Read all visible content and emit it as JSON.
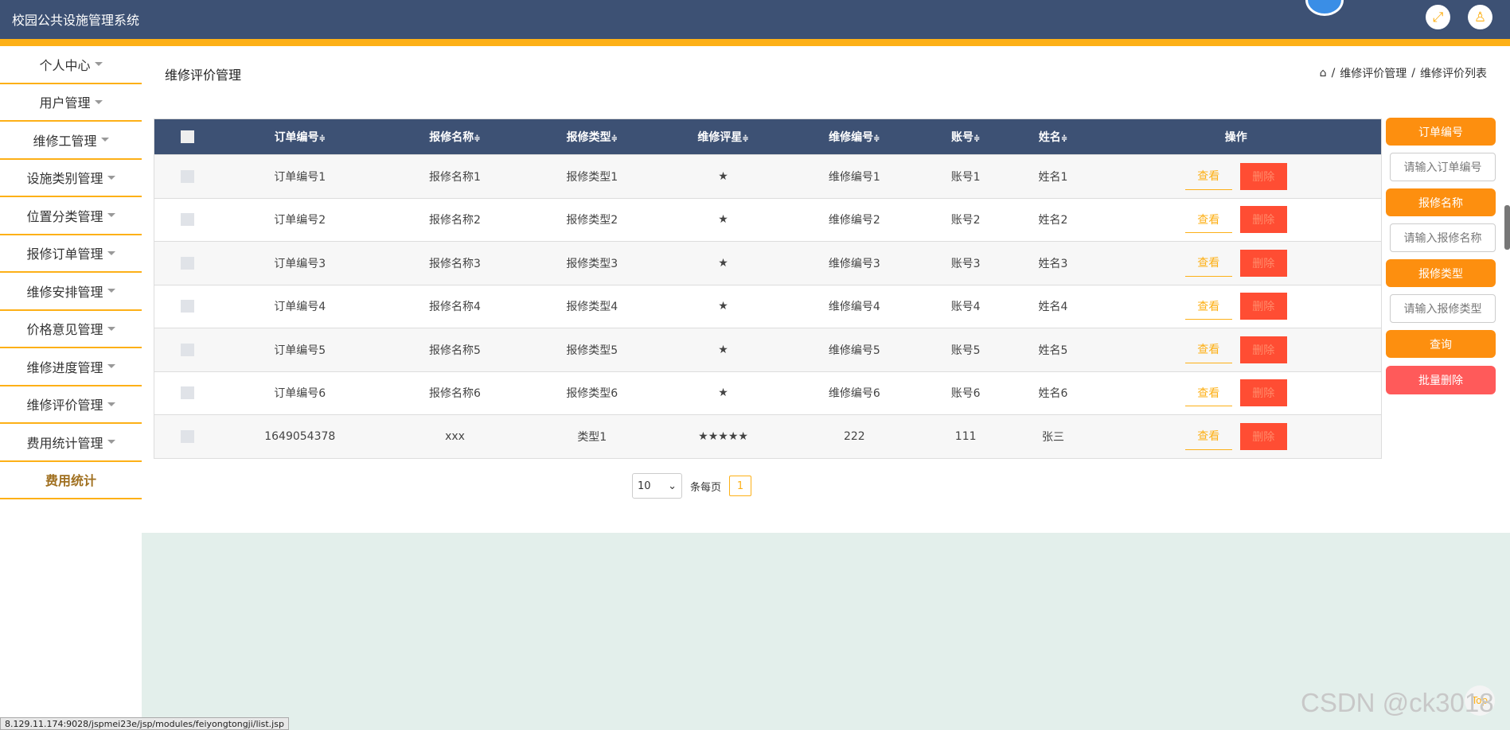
{
  "app": {
    "title": "校园公共设施管理系统"
  },
  "sidebar": {
    "items": [
      {
        "label": "个人中心",
        "caret": true
      },
      {
        "label": "用户管理",
        "caret": true
      },
      {
        "label": "维修工管理",
        "caret": true
      },
      {
        "label": "设施类别管理",
        "caret": true
      },
      {
        "label": "位置分类管理",
        "caret": true
      },
      {
        "label": "报修订单管理",
        "caret": true
      },
      {
        "label": "维修安排管理",
        "caret": true
      },
      {
        "label": "价格意见管理",
        "caret": true
      },
      {
        "label": "维修进度管理",
        "caret": true
      },
      {
        "label": "维修评价管理",
        "caret": true
      },
      {
        "label": "费用统计管理",
        "caret": true
      },
      {
        "label": "费用统计",
        "caret": false
      }
    ]
  },
  "page": {
    "title": "维修评价管理"
  },
  "breadcrumb": {
    "home_icon": "home-icon",
    "sep": "/",
    "level1": "维修评价管理",
    "level2": "维修评价列表"
  },
  "table": {
    "headers": [
      "订单编号",
      "报修名称",
      "报修类型",
      "维修评星",
      "维修编号",
      "账号",
      "姓名",
      "操作"
    ],
    "sort_glyph": "≑",
    "view_label": "查看",
    "delete_label": "删除",
    "rows": [
      [
        "订单编号1",
        "报修名称1",
        "报修类型1",
        "★",
        "维修编号1",
        "账号1",
        "姓名1"
      ],
      [
        "订单编号2",
        "报修名称2",
        "报修类型2",
        "★",
        "维修编号2",
        "账号2",
        "姓名2"
      ],
      [
        "订单编号3",
        "报修名称3",
        "报修类型3",
        "★",
        "维修编号3",
        "账号3",
        "姓名3"
      ],
      [
        "订单编号4",
        "报修名称4",
        "报修类型4",
        "★",
        "维修编号4",
        "账号4",
        "姓名4"
      ],
      [
        "订单编号5",
        "报修名称5",
        "报修类型5",
        "★",
        "维修编号5",
        "账号5",
        "姓名5"
      ],
      [
        "订单编号6",
        "报修名称6",
        "报修类型6",
        "★",
        "维修编号6",
        "账号6",
        "姓名6"
      ],
      [
        "1649054378",
        "xxx",
        "类型1",
        "★★★★★",
        "222",
        "111",
        "张三"
      ]
    ]
  },
  "pager": {
    "page_size": "10",
    "per_page_label": "条每页",
    "current_page": "1"
  },
  "search": {
    "order_label": "订单编号",
    "order_placeholder": "请输入订单编号",
    "name_label": "报修名称",
    "name_placeholder": "请输入报修名称",
    "type_label": "报修类型",
    "type_placeholder": "请输入报修类型",
    "query_label": "查询",
    "batch_delete_label": "批量删除"
  },
  "status_bar": {
    "url": "8.129.11.174:9028/jspmei23e/jsp/modules/feiyongtongji/list.jsp"
  },
  "watermark": "CSDN @ck3018",
  "back_to_top": "Top",
  "colors": {
    "topbar": "#3d5174",
    "accent": "#fdb017",
    "button": "#fd8f0f",
    "danger": "#ff4d33"
  }
}
